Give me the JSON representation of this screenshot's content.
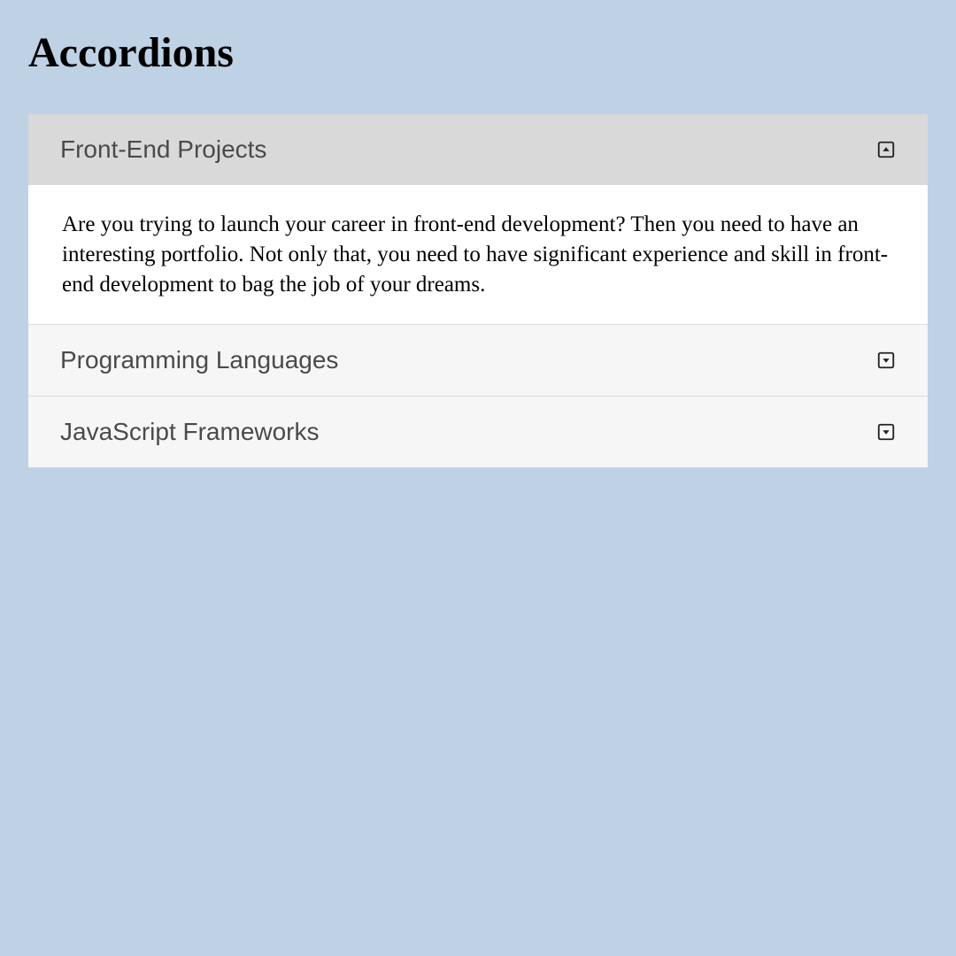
{
  "page": {
    "title": "Accordions"
  },
  "accordions": [
    {
      "title": "Front-End Projects",
      "expanded": true,
      "content": "Are you trying to launch your career in front-end development? Then you need to have an interesting portfolio. Not only that, you need to have significant experience and skill in front-end development to bag the job of your dreams."
    },
    {
      "title": "Programming Languages",
      "expanded": false,
      "content": ""
    },
    {
      "title": "JavaScript Frameworks",
      "expanded": false,
      "content": ""
    }
  ],
  "colors": {
    "background": "#bfd1e5",
    "header_active": "#d9d9d9",
    "header_inactive": "#f6f6f6",
    "content_bg": "#ffffff",
    "title_text": "#4a4a4a"
  }
}
